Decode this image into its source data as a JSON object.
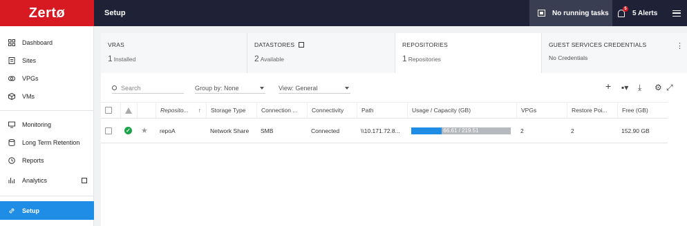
{
  "brand": {
    "logo_text": "Zertø",
    "color": "#d71921"
  },
  "header": {
    "title": "Setup",
    "tasks_label": "No running tasks",
    "alerts_label": "5 Alerts",
    "alerts_badge": "5",
    "accent": "#1f2236"
  },
  "sidebar": {
    "items": [
      {
        "label": "Dashboard",
        "icon": "grid-icon"
      },
      {
        "label": "Sites",
        "icon": "document-icon"
      },
      {
        "label": "VPGs",
        "icon": "shield-icon"
      },
      {
        "label": "VMs",
        "icon": "cube-icon"
      },
      {
        "label": "Monitoring",
        "icon": "monitor-icon"
      },
      {
        "label": "Long Term Retention",
        "icon": "database-icon"
      },
      {
        "label": "Reports",
        "icon": "clock-icon"
      },
      {
        "label": "Analytics",
        "icon": "bar-chart-icon"
      },
      {
        "label": "Setup",
        "icon": "link-icon",
        "active": true
      }
    ],
    "active_color": "#1f8ce6"
  },
  "tabs": [
    {
      "label": "VRAS",
      "count": "1",
      "sub": "Installed"
    },
    {
      "label": "DATASTORES",
      "count": "2",
      "sub": "Available"
    },
    {
      "label": "REPOSITORIES",
      "count": "1",
      "sub": "Repositories",
      "active": true
    },
    {
      "label": "GUEST SERVICES CREDENTIALS",
      "text": "No Credentials"
    }
  ],
  "toolbar": {
    "search_placeholder": "Search",
    "group_by": "Group by: None",
    "view": "View: General"
  },
  "table": {
    "columns": [
      "Reposito...",
      "Storage Type",
      "Connection ...",
      "Connectivity",
      "Path",
      "Usage / Capacity (GB)",
      "VPGs",
      "Restore Poi...",
      "Free (GB)"
    ],
    "rows": [
      {
        "name": "repoA",
        "storage_type": "Network Share",
        "connection": "SMB",
        "connectivity": "Connected",
        "path": "\\\\10.171.72.8...",
        "usage_label": "66.61 / 219.51",
        "usage_fraction": 0.3034,
        "vpgs": "2",
        "restore_points": "2",
        "free": "152.90 GB"
      }
    ]
  }
}
